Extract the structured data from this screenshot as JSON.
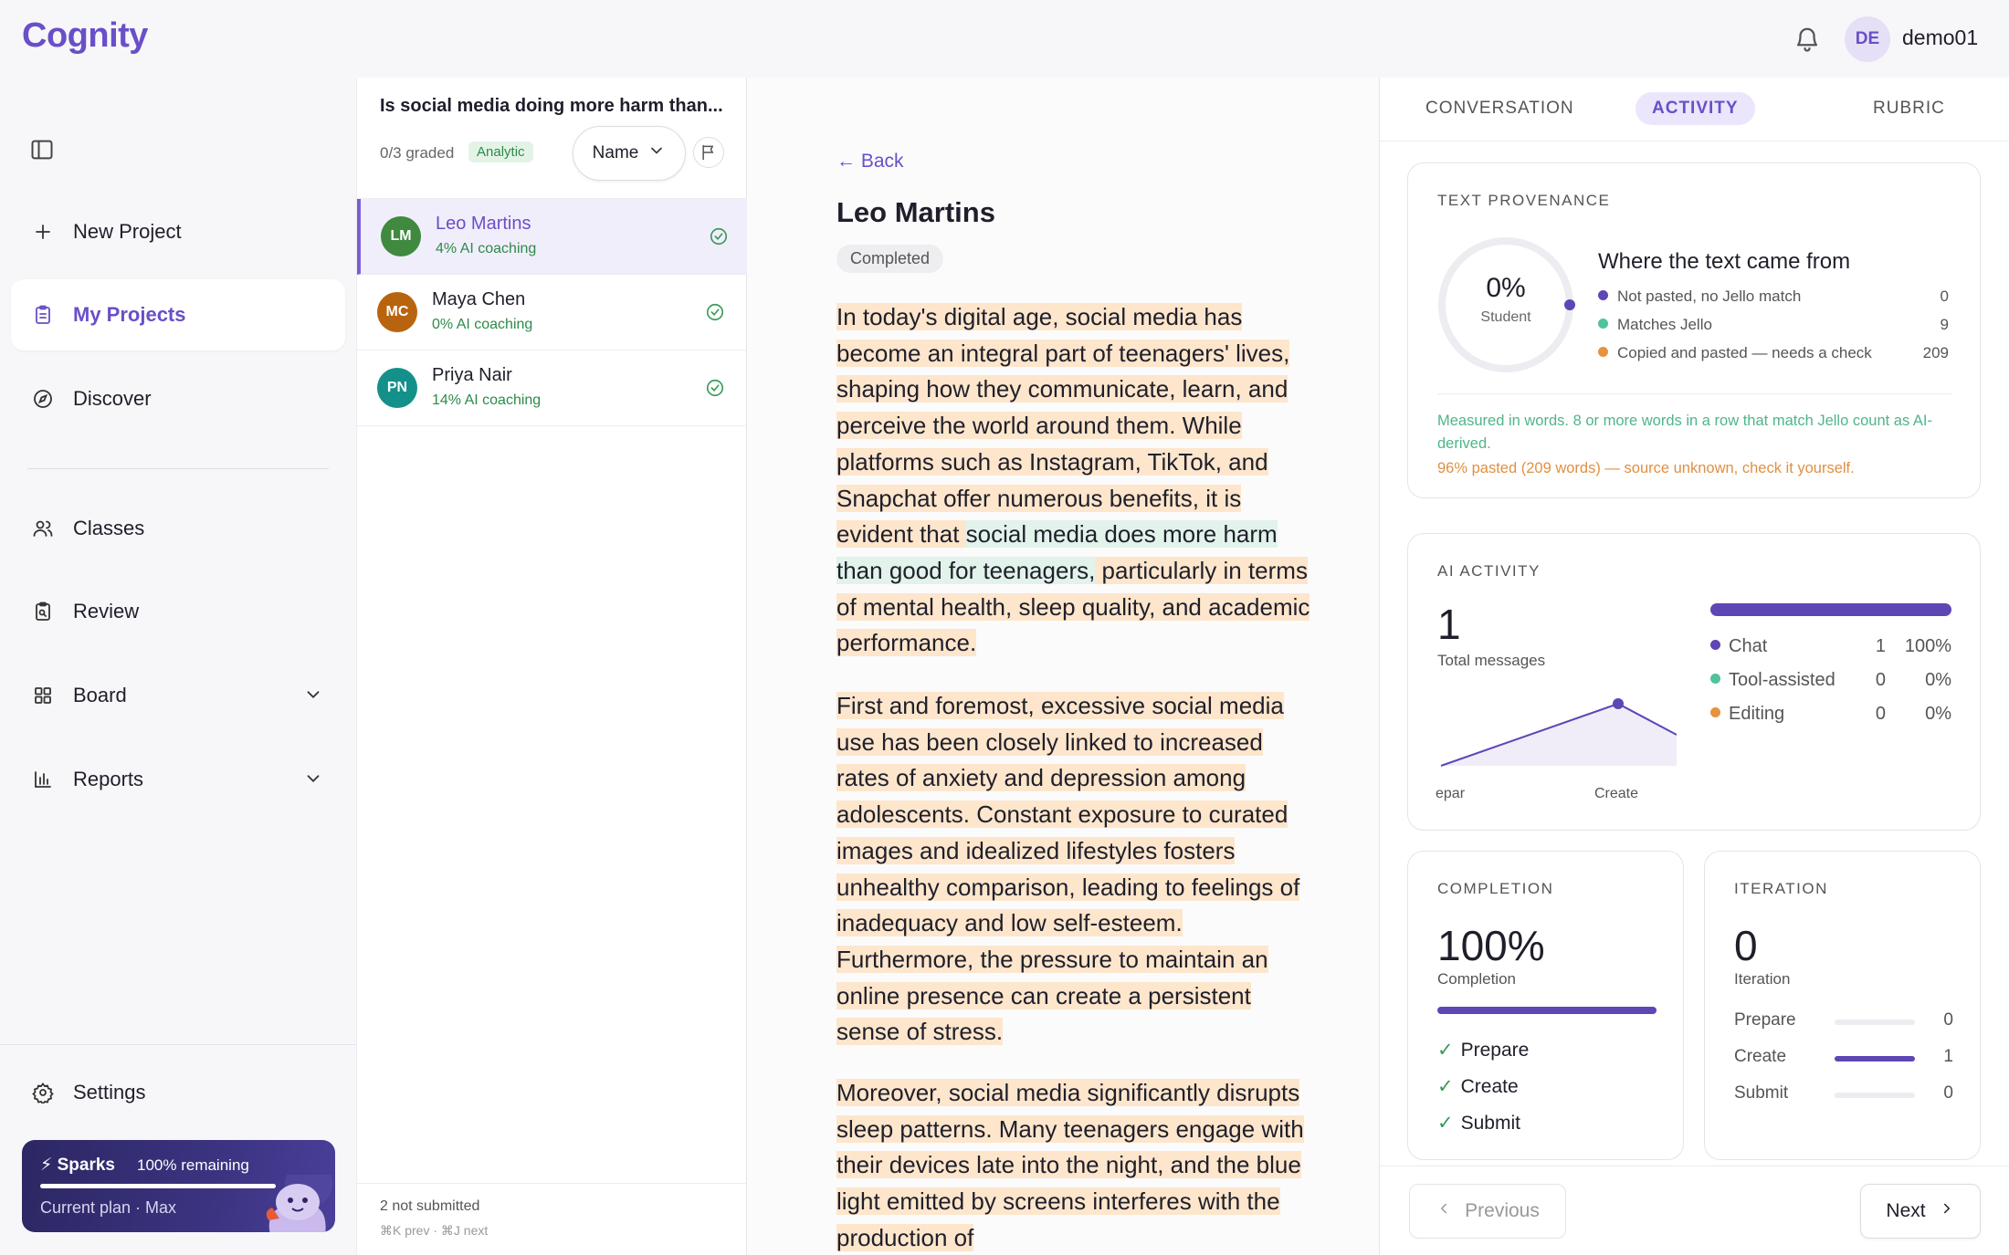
{
  "app": {
    "logo": "Cognity"
  },
  "user": {
    "initials": "DE",
    "name": "demo01"
  },
  "sidebar": {
    "new_project": "New Project",
    "items": [
      {
        "label": "My Projects",
        "icon": "clipboard-icon",
        "active": true
      },
      {
        "label": "Discover",
        "icon": "compass-icon"
      },
      {
        "label": "Classes",
        "icon": "users-icon"
      },
      {
        "label": "Review",
        "icon": "review-icon"
      },
      {
        "label": "Board",
        "icon": "grid-icon"
      },
      {
        "label": "Reports",
        "icon": "bar-chart-icon"
      }
    ],
    "settings": "Settings",
    "sparks": {
      "title": "⚡ Sparks",
      "remaining": "100% remaining",
      "plan": "Current plan · Max",
      "progress": 1.0
    }
  },
  "list": {
    "title": "Is social media doing more harm than...",
    "graded": "0/3 graded",
    "badge": "Analytic",
    "sort_label": "Name",
    "students": [
      {
        "initials": "LM",
        "name": "Leo Martins",
        "sub": "4% AI coaching",
        "color": "#3f8a3f",
        "selected": true
      },
      {
        "initials": "MC",
        "name": "Maya Chen",
        "sub": "0% AI coaching",
        "color": "#b8640f"
      },
      {
        "initials": "PN",
        "name": "Priya Nair",
        "sub": "14% AI coaching",
        "color": "#14908a"
      }
    ],
    "not_submitted": "2 not submitted",
    "shortcuts": "⌘K prev · ⌘J next"
  },
  "doc": {
    "back": "Back",
    "student": "Leo Martins",
    "status": "Completed",
    "p1a": "In today's digital age, social media has become an integral part of teenagers' lives, shaping how they communicate, learn, and perceive the world around them. While platforms such as Instagram, TikTok, and Snapchat offer numerous benefits, it is evident that ",
    "p1b": "social media does more harm than good for teenagers,",
    "p1c": " particularly in terms of mental health, sleep quality, and academic performance.",
    "p2": "First and foremost, excessive social media use has been closely linked to increased rates of anxiety and depression among adolescents. Constant exposure to curated images and idealized lifestyles fosters unhealthy comparison, leading to feelings of inadequacy and low self-esteem. Furthermore, the pressure to maintain an online presence can create a persistent sense of stress.",
    "p3": "Moreover, social media significantly disrupts sleep patterns. Many teenagers engage with their devices late into the night, and the blue light emitted by screens interferes with the production of"
  },
  "tabs": {
    "conversation": "CONVERSATION",
    "activity": "ACTIVITY",
    "rubric": "RUBRIC"
  },
  "provenance": {
    "label": "TEXT PROVENANCE",
    "pct": "0%",
    "pct_sub": "Student",
    "heading": "Where the text came from",
    "legend": [
      {
        "label": "Not pasted, no Jello match",
        "value": "0",
        "color": "#5e46b5"
      },
      {
        "label": "Matches Jello",
        "value": "9",
        "color": "#4fc39a"
      },
      {
        "label": "Copied and pasted — needs a check",
        "value": "209",
        "color": "#e6923f"
      }
    ],
    "note": "Measured in words. 8 or more words in a row that match Jello count as AI-derived.",
    "warning": "96% pasted (209 words) — source unknown, check it yourself."
  },
  "ai_activity": {
    "label": "AI ACTIVITY",
    "total": "1",
    "total_label": "Total messages",
    "rows": [
      {
        "label": "Chat",
        "count": "1",
        "pct": "100%",
        "color": "#5e46b5"
      },
      {
        "label": "Tool-assisted",
        "count": "0",
        "pct": "0%",
        "color": "#4fc39a"
      },
      {
        "label": "Editing",
        "count": "0",
        "pct": "0%",
        "color": "#e6923f"
      }
    ],
    "chart_labels": [
      "epar",
      "Create"
    ]
  },
  "completion": {
    "label": "COMPLETION",
    "value": "100%",
    "sub": "Completion",
    "progress": 1.0,
    "steps": [
      "Prepare",
      "Create",
      "Submit"
    ]
  },
  "iteration": {
    "label": "ITERATION",
    "value": "0",
    "sub": "Iteration",
    "rows": [
      {
        "label": "Prepare",
        "value": "0",
        "fill": 0
      },
      {
        "label": "Create",
        "value": "1",
        "fill": 1
      },
      {
        "label": "Submit",
        "value": "0",
        "fill": 0
      }
    ]
  },
  "nav": {
    "previous": "Previous",
    "next": "Next"
  }
}
